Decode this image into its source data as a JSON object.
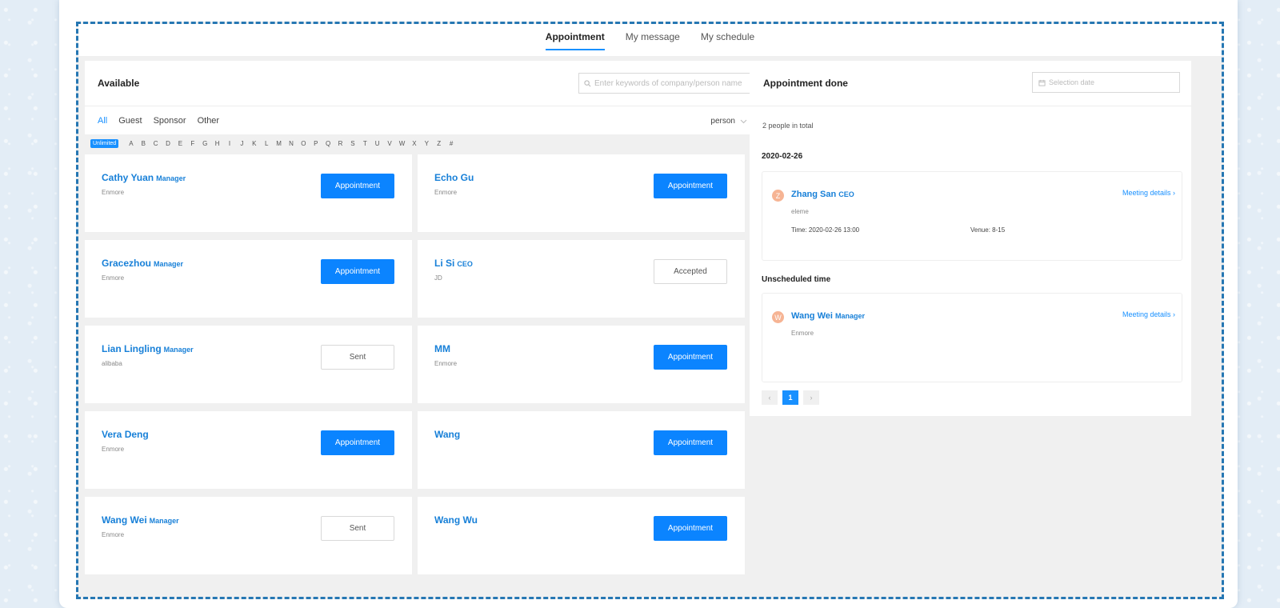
{
  "tabs": [
    {
      "label": "Appointment",
      "active": true
    },
    {
      "label": "My message",
      "active": false
    },
    {
      "label": "My schedule",
      "active": false
    }
  ],
  "left": {
    "title": "Available",
    "search_placeholder": "Enter keywords of company/person name",
    "filters": [
      "All",
      "Guest",
      "Sponsor",
      "Other"
    ],
    "active_filter": "All",
    "person_select": "person",
    "alpha_unlimited": "Unlimited",
    "alphabet": [
      "A",
      "B",
      "C",
      "D",
      "E",
      "F",
      "G",
      "H",
      "I",
      "J",
      "K",
      "L",
      "M",
      "N",
      "O",
      "P",
      "Q",
      "R",
      "S",
      "T",
      "U",
      "V",
      "W",
      "X",
      "Y",
      "Z",
      "#"
    ]
  },
  "cards": [
    {
      "name": "Cathy Yuan",
      "role": "Manager",
      "company": "Enmore",
      "button": "Appointment",
      "state": "primary"
    },
    {
      "name": "Echo Gu",
      "role": "",
      "company": "Enmore",
      "button": "Appointment",
      "state": "primary"
    },
    {
      "name": "Gracezhou",
      "role": "Manager",
      "company": "Enmore",
      "button": "Appointment",
      "state": "primary"
    },
    {
      "name": "Li Si",
      "role": "CEO",
      "company": "JD",
      "button": "Accepted",
      "state": "ghost"
    },
    {
      "name": "Lian Lingling",
      "role": "Manager",
      "company": "alibaba",
      "button": "Sent",
      "state": "ghost"
    },
    {
      "name": "MM",
      "role": "",
      "company": "Enmore",
      "button": "Appointment",
      "state": "primary"
    },
    {
      "name": "Vera Deng",
      "role": "",
      "company": "Enmore",
      "button": "Appointment",
      "state": "primary"
    },
    {
      "name": "Wang",
      "role": "",
      "company": "",
      "button": "Appointment",
      "state": "primary"
    },
    {
      "name": "Wang Wei",
      "role": "Manager",
      "company": "Enmore",
      "button": "Sent",
      "state": "ghost"
    },
    {
      "name": "Wang Wu",
      "role": "",
      "company": "",
      "button": "Appointment",
      "state": "primary"
    }
  ],
  "right": {
    "title": "Appointment done",
    "date_placeholder": "Selection date",
    "total": "2 people in total",
    "date_group": "2020-02-26",
    "unscheduled_label": "Unscheduled time",
    "meetings": [
      {
        "initial": "Z",
        "name": "Zhang San",
        "role": "CEO",
        "company": "eleme",
        "time": "Time:  2020-02-26 13:00",
        "venue": "Venue:  8-15",
        "link": "Meeting details ›"
      },
      {
        "initial": "W",
        "name": "Wang Wei",
        "role": "Manager",
        "company": "Enmore",
        "time": "",
        "venue": "",
        "link": "Meeting details ›"
      }
    ],
    "pager": {
      "prev": "‹",
      "current": "1",
      "next": "›"
    }
  },
  "colors": {
    "accent": "#1890ff",
    "name_blue": "#1880d8",
    "dashed_border": "#2677b3",
    "avatar": "#f6b494"
  }
}
